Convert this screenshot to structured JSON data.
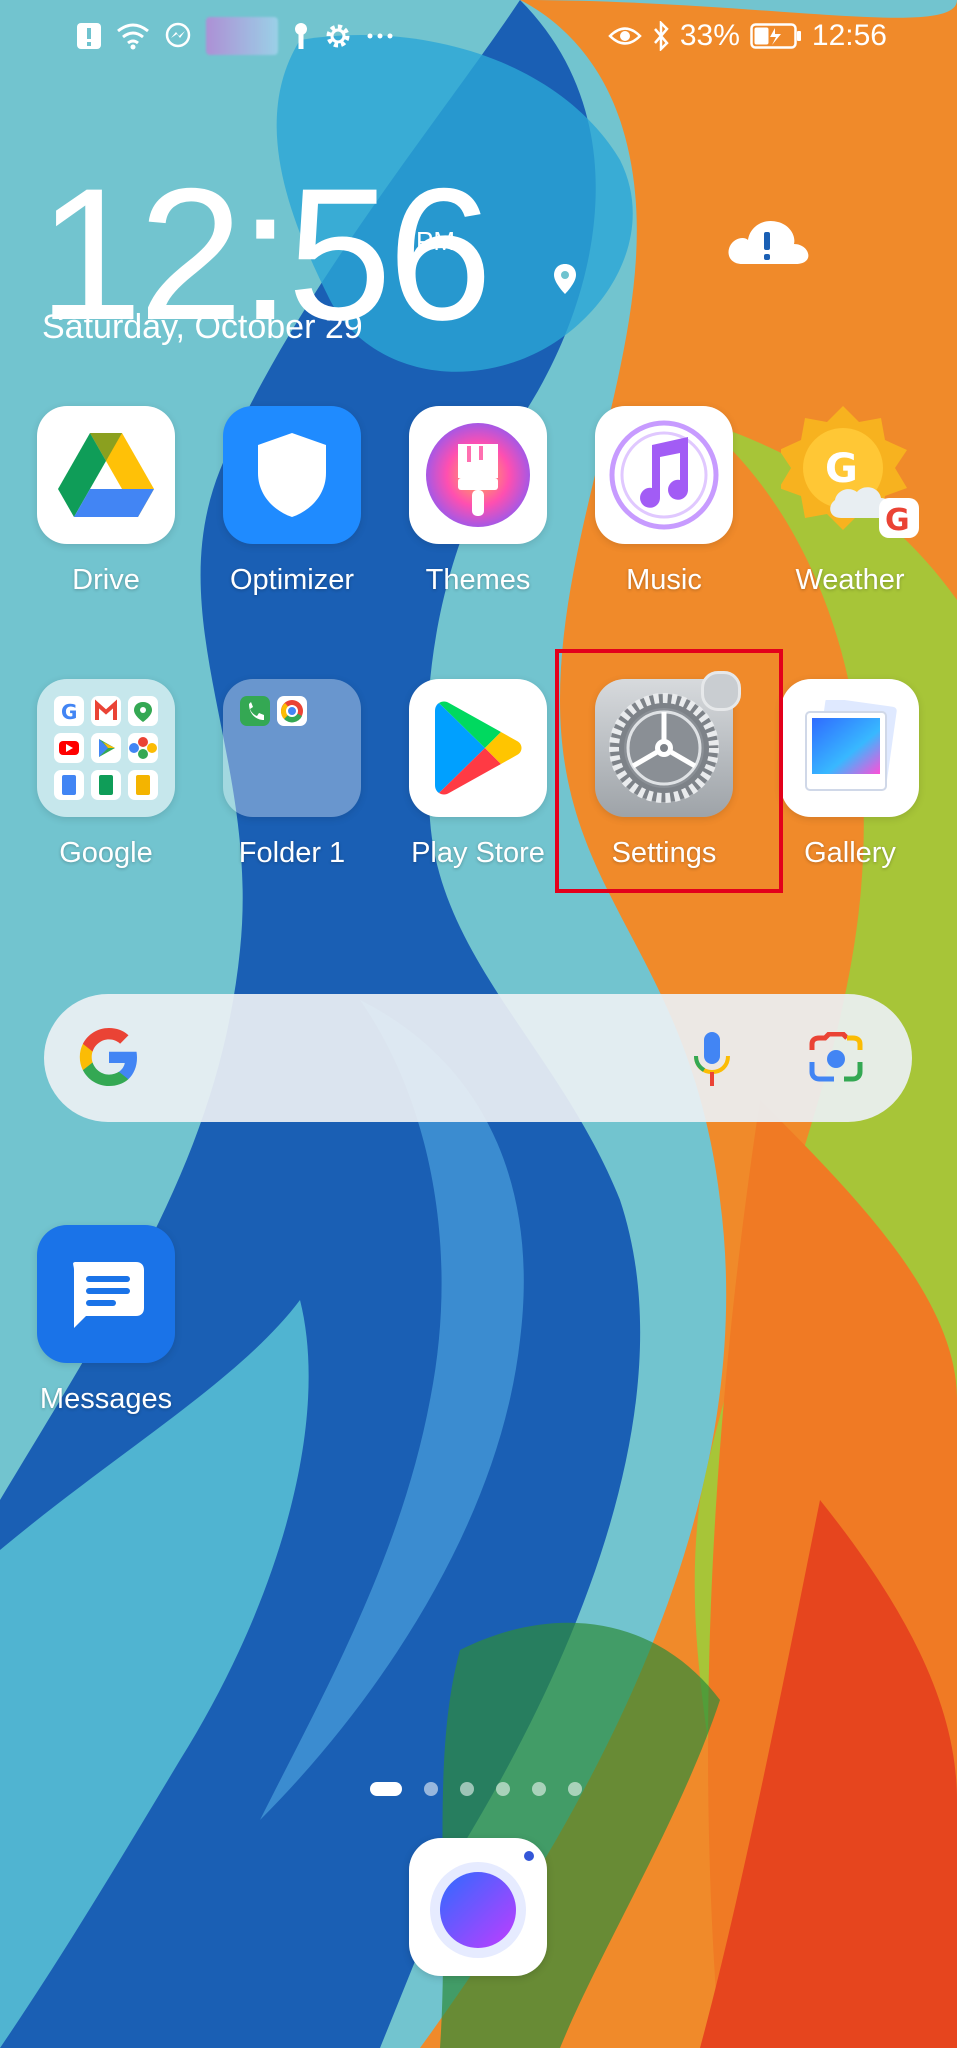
{
  "status_bar": {
    "battery_percent": "33%",
    "time": "12:56",
    "icons": [
      "alert-icon",
      "wifi-icon",
      "messenger-icon",
      "key-icon",
      "gear-icon",
      "more-icon",
      "eye-icon",
      "bluetooth-icon",
      "battery-icon"
    ]
  },
  "clock": {
    "time": "12:56",
    "ampm": "PM",
    "date": "Saturday, October 29"
  },
  "apps_row1": [
    {
      "label": "Drive"
    },
    {
      "label": "Optimizer"
    },
    {
      "label": "Themes"
    },
    {
      "label": "Music"
    },
    {
      "label": "Weather"
    }
  ],
  "apps_row2": [
    {
      "label": "Google"
    },
    {
      "label": "Folder 1"
    },
    {
      "label": "Play Store"
    },
    {
      "label": "Settings"
    },
    {
      "label": "Gallery"
    }
  ],
  "apps_row3": [
    {
      "label": "Messages"
    }
  ],
  "search_bar": {
    "icons": [
      "google-logo-icon",
      "microphone-icon",
      "lens-camera-icon"
    ]
  },
  "pager": {
    "pages": 6,
    "active": 1
  },
  "colors": {
    "highlight": "#e3001b",
    "optimizer_blue": "#1f8bff",
    "messages_blue": "#1a73e8"
  }
}
